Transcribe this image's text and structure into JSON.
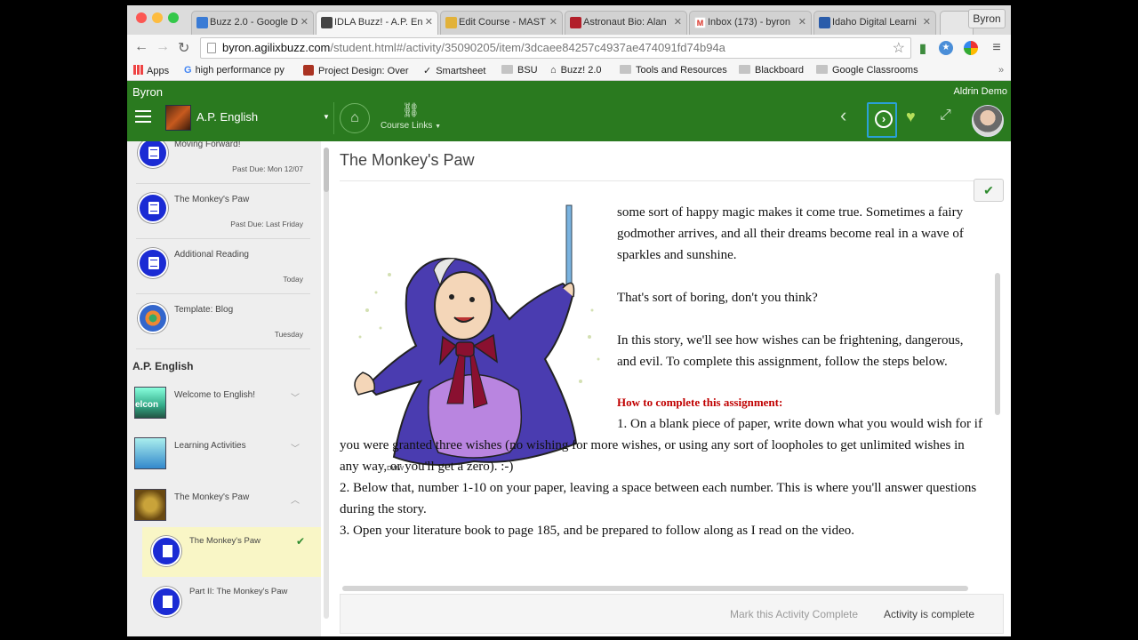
{
  "browser": {
    "tabs": [
      {
        "label": "Buzz 2.0 - Google D",
        "favicon_color": "#3a7bd5"
      },
      {
        "label": "IDLA Buzz! - A.P. En",
        "favicon_color": "#444444"
      },
      {
        "label": "Edit Course - MAST",
        "favicon_color": "#e2b23a"
      },
      {
        "label": "Astronaut Bio: Alan",
        "favicon_color": "#b21f2a"
      },
      {
        "label": "Inbox (173) - byron",
        "favicon_color": "#d93025"
      },
      {
        "label": "Idaho Digital Learni",
        "favicon_color": "#2a5caa"
      }
    ],
    "profile_name": "Byron",
    "url_host": "byron.agilixbuzz.com",
    "url_path": "/student.html#/activity/35090205/item/3dcaee84257c4937ae474091fd74b94a",
    "bookmarks": [
      "Apps",
      "high performance py",
      "Project Design: Over",
      "Smartsheet",
      "BSU",
      "Buzz! 2.0",
      "Tools and Resources",
      "Blackboard",
      "Google Classrooms"
    ],
    "bookmarks_more": "»"
  },
  "app": {
    "user_short": "Byron",
    "user_demo": "Aldrin Demo",
    "course_name": "A.P. English",
    "course_links": "Course Links",
    "accent_color": "#2a7a1f"
  },
  "sidebar": {
    "activities": [
      {
        "title": "Moving Forward!",
        "due": "Past Due: Mon 12/07"
      },
      {
        "title": "The Monkey's Paw",
        "due": "Past Due: Last Friday"
      },
      {
        "title": "Additional Reading",
        "due": "Today"
      },
      {
        "title": "Template: Blog",
        "due": "Tuesday"
      }
    ],
    "section_title": "A.P. English",
    "units": [
      {
        "title": "Welcome to English!",
        "thumb_text": "elcon"
      },
      {
        "title": "Learning Activities"
      },
      {
        "title": "The Monkey's Paw"
      }
    ],
    "sub_items": [
      {
        "title": "The Monkey's Paw",
        "completed": true
      },
      {
        "title": "Part II: The Monkey's Paw"
      }
    ]
  },
  "main": {
    "title": "The Monkey's Paw",
    "illustration_signature": "DWW",
    "paragraphs": [
      "some sort of happy magic makes it come true. Sometimes a fairy godmother arrives, and all their dreams become real in a wave of sparkles and sunshine.",
      "That's sort of boring, don't you think?",
      "In this story, we'll see how wishes can be frightening, dangerous, and evil. To complete this assignment, follow the steps below."
    ],
    "instructions_heading": "How to complete this assignment:",
    "steps": [
      "1. On a blank piece of paper, write down what you would wish for if you were granted three wishes (no wishing for more wishes, or using any sort of loopholes to get unlimited wishes in any way, or you'll get a zero). :-)",
      "2. Below that, number 1-10 on your paper, leaving a space between each number. This is where you'll answer questions during the story.",
      "3. Open your literature book to page 185, and be prepared to follow along as I read on the video."
    ],
    "mark_complete_label": "Mark this Activity Complete",
    "status_label": "Activity is complete"
  }
}
